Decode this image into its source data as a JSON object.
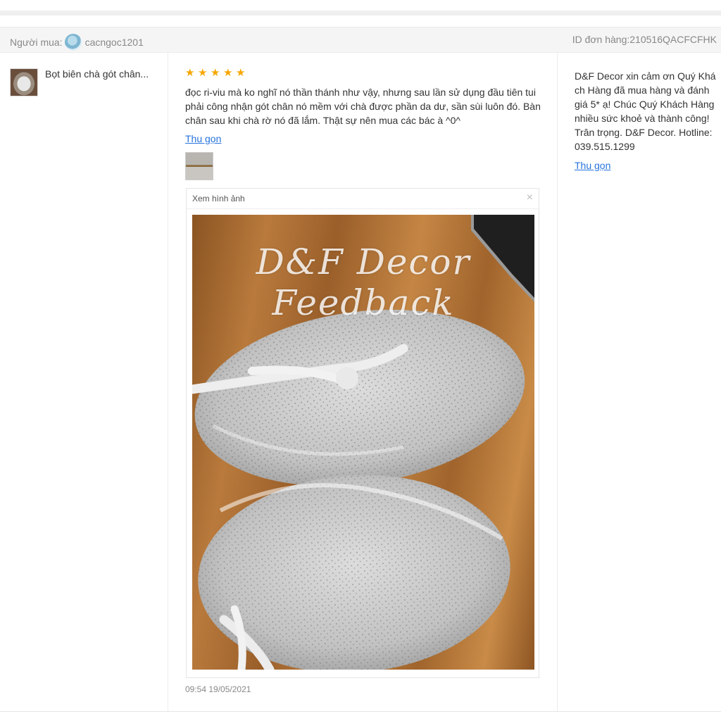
{
  "header": {
    "buyer_label": "Người mua:",
    "buyer_name": "cacngoc1201",
    "order_id": "ID đơn hàng:210516QACFCFHK"
  },
  "product": {
    "name": "Bọt biên chà gót chân..."
  },
  "review": {
    "rating": 5,
    "stars": [
      "★",
      "★",
      "★",
      "★",
      "★"
    ],
    "text": "đọc ri-viu mà ko nghĩ nó thần thánh như vậy, nhưng sau lần sử dụng đầu tiên tui phải công nhận gót chân nó mềm với chà được phần da dư, sần sùi luôn đó. Bàn chân sau khi chà rờ nó đã lắm. Thật sự nên mua các bác à ^0^",
    "collapse_label": "Thu gọn",
    "timestamp": "09:54 19/05/2021"
  },
  "viewer": {
    "title": "Xem hình ảnh",
    "close_icon": "×",
    "watermark_line1": "D&F Decor",
    "watermark_line2": "Feedback"
  },
  "reply": {
    "text": "D&F Decor xin cảm ơn Quý Khách Hàng đã mua hàng và đánh giá 5* ạ! Chúc Quý Khách Hàng nhiều sức khoẻ và thành công! Trân trọng. D&F Decor. Hotline: 039.515.1299",
    "collapse_label": "Thu gọn"
  }
}
